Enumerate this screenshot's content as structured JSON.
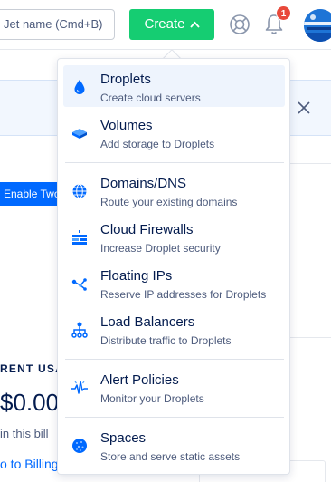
{
  "topbar": {
    "search_placeholder": "Jet name (Cmd+B)",
    "create_label": "Create",
    "notification_count": "1"
  },
  "page": {
    "enable_2fa_label": "Enable Two-Factor",
    "usage_label": "RENT USA",
    "usage_amount": "$0.00",
    "usage_sub": "in this bill",
    "billing_link": "o to Billing"
  },
  "menu": {
    "items": [
      {
        "title": "Droplets",
        "desc": "Create cloud servers",
        "icon": "droplet-icon"
      },
      {
        "title": "Volumes",
        "desc": "Add storage to Droplets",
        "icon": "volume-icon"
      },
      {
        "title": "Domains/DNS",
        "desc": "Route your existing domains",
        "icon": "globe-icon"
      },
      {
        "title": "Cloud Firewalls",
        "desc": "Increase Droplet security",
        "icon": "firewall-icon"
      },
      {
        "title": "Floating IPs",
        "desc": "Reserve IP addresses for Droplets",
        "icon": "floating-ip-icon"
      },
      {
        "title": "Load Balancers",
        "desc": "Distribute traffic to Droplets",
        "icon": "load-balancer-icon"
      },
      {
        "title": "Alert Policies",
        "desc": "Monitor your Droplets",
        "icon": "alert-pulse-icon"
      },
      {
        "title": "Spaces",
        "desc": "Store and serve static assets",
        "icon": "spaces-icon"
      }
    ]
  },
  "colors": {
    "accent_green": "#15cd72",
    "brand_blue": "#0069ff",
    "text_dark": "#031b4e",
    "badge_red": "#e8483a"
  }
}
